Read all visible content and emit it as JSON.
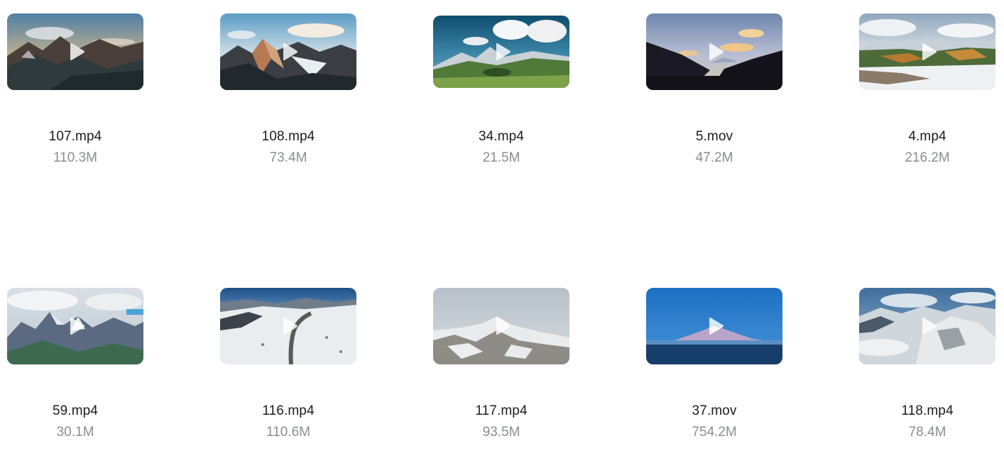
{
  "files": [
    {
      "name": "107.mp4",
      "size": "110.3M",
      "scene": "dusk-peaks"
    },
    {
      "name": "108.mp4",
      "size": "73.4M",
      "scene": "golden-ridge"
    },
    {
      "name": "34.mp4",
      "size": "21.5M",
      "scene": "green-valley"
    },
    {
      "name": "5.mov",
      "size": "47.2M",
      "scene": "sunset-silhouette"
    },
    {
      "name": "4.mp4",
      "size": "216.2M",
      "scene": "autumn-snow"
    },
    {
      "name": "59.mp4",
      "size": "30.1M",
      "scene": "cloudy-range"
    },
    {
      "name": "116.mp4",
      "size": "110.6M",
      "scene": "snow-road"
    },
    {
      "name": "117.mp4",
      "size": "93.5M",
      "scene": "foggy-summit"
    },
    {
      "name": "37.mov",
      "size": "754.2M",
      "scene": "blue-peak"
    },
    {
      "name": "118.mp4",
      "size": "78.4M",
      "scene": "snow-slopes"
    }
  ],
  "colors": {
    "file_name": "#1c1c1e",
    "file_size": "#8a8d92",
    "background": "#ffffff"
  },
  "icons": {
    "play": "play-icon"
  }
}
